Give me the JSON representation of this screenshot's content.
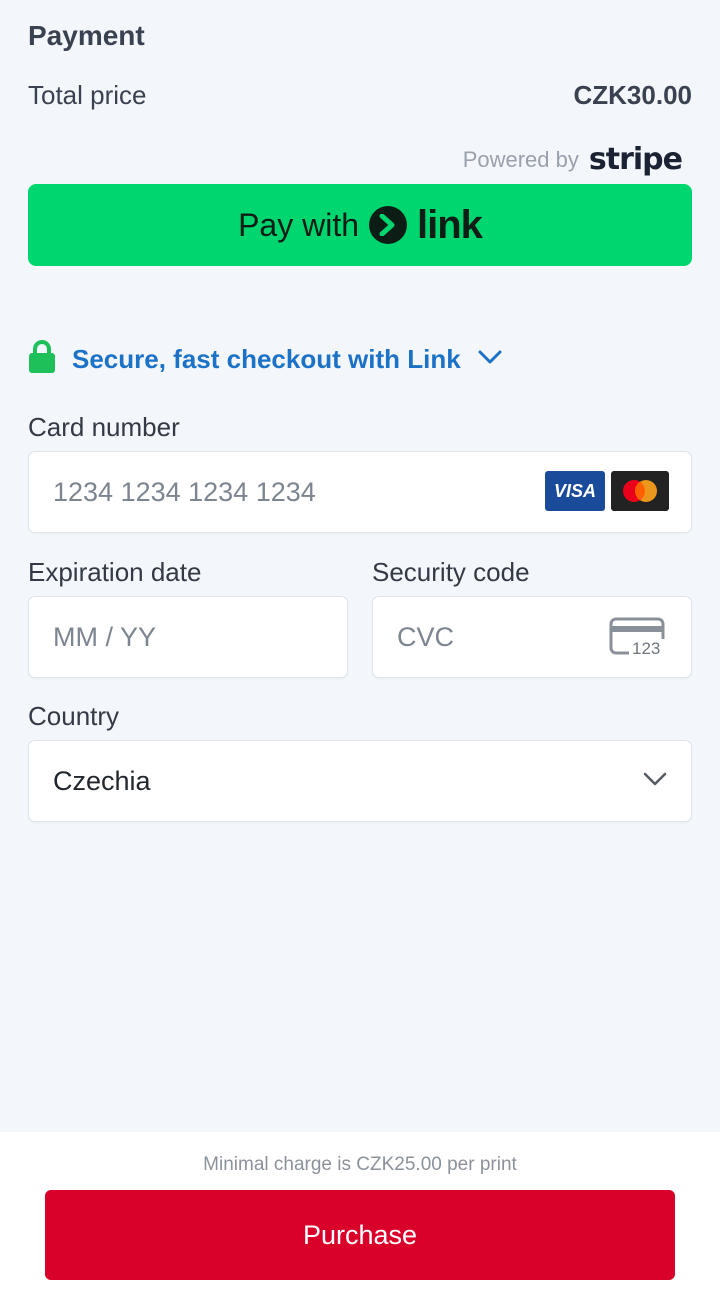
{
  "header": {
    "title": "Payment",
    "total_label": "Total price",
    "total_value": "CZK30.00"
  },
  "powered_by": {
    "text": "Powered by",
    "brand": "stripe"
  },
  "link_button": {
    "prefix": "Pay with",
    "wordmark": "link",
    "color": "#00d66f"
  },
  "secure_link": {
    "label": "Secure, fast checkout with Link",
    "color": "#1b72c7",
    "lock_color": "#1ec05a"
  },
  "card_number": {
    "label": "Card number",
    "placeholder": "1234 1234 1234 1234",
    "brands": [
      "VISA",
      "mastercard"
    ]
  },
  "expiration": {
    "label": "Expiration date",
    "placeholder": "MM / YY"
  },
  "security_code": {
    "label": "Security code",
    "placeholder": "CVC",
    "icon_text": "123"
  },
  "country": {
    "label": "Country",
    "value": "Czechia"
  },
  "footer": {
    "min_charge": "Minimal charge is CZK25.00 per print",
    "purchase_label": "Purchase",
    "purchase_color": "#d9002a"
  }
}
